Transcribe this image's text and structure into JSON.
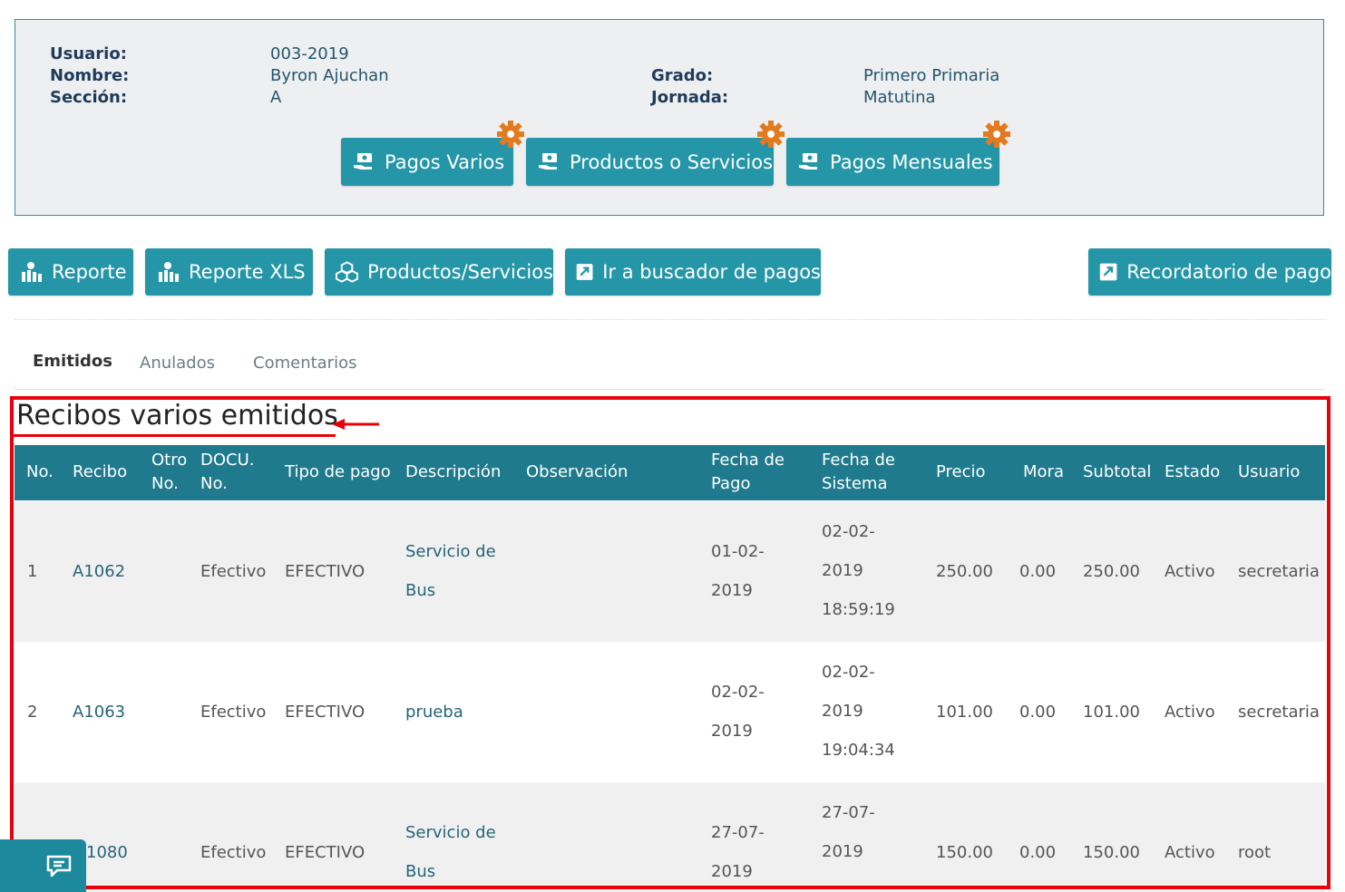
{
  "student": {
    "usuario_label": "Usuario:",
    "usuario_value": "003-2019",
    "nombre_label": "Nombre:",
    "nombre_value": "Byron Ajuchan",
    "seccion_label": "Sección:",
    "seccion_value": "A",
    "grado_label": "Grado:",
    "grado_value": "Primero Primaria",
    "jornada_label": "Jornada:",
    "jornada_value": "Matutina"
  },
  "payment_buttons": {
    "pagos_varios": "Pagos Varios",
    "productos_servicios": "Productos o Servicios",
    "pagos_mensuales": "Pagos Mensuales"
  },
  "actions": {
    "reporte": "Reporte",
    "reporte_xls": "Reporte XLS",
    "productos": "Productos/Servicios",
    "buscador": "Ir a buscador de pagos",
    "recordatorio": "Recordatorio de pago"
  },
  "tabs": [
    "Emitidos",
    "Anulados",
    "Comentarios"
  ],
  "section_title": "Recibos varios emitidos",
  "table": {
    "headers": {
      "no": "No.",
      "recibo": "Recibo",
      "otro_1": "Otro",
      "otro_2": "No.",
      "docu_1": "DOCU.",
      "docu_2": "No.",
      "tipo": "Tipo de pago",
      "descripcion": "Descripción",
      "observacion": "Observación",
      "fpago_1": "Fecha de",
      "fpago_2": "Pago",
      "fsis_1": "Fecha de",
      "fsis_2": "Sistema",
      "precio": "Precio",
      "mora": "Mora",
      "subtotal": "Subtotal",
      "estado": "Estado",
      "usuario": "Usuario"
    },
    "rows": [
      {
        "no": "1",
        "recibo": "A1062",
        "docu": "Efectivo",
        "tipo": "EFECTIVO",
        "desc_1": "Servicio de",
        "desc_2": "Bus",
        "fpago_1": "01-02-",
        "fpago_2": "2019",
        "fsis_1": "02-02-",
        "fsis_2": "2019",
        "fsis_3": "18:59:19",
        "precio": "250.00",
        "mora": "0.00",
        "subtotal": "250.00",
        "estado": "Activo",
        "usuario": "secretaria"
      },
      {
        "no": "2",
        "recibo": "A1063",
        "docu": "Efectivo",
        "tipo": "EFECTIVO",
        "desc_1": "prueba",
        "fpago_1": "02-02-",
        "fpago_2": "2019",
        "fsis_1": "02-02-",
        "fsis_2": "2019",
        "fsis_3": "19:04:34",
        "precio": "101.00",
        "mora": "0.00",
        "subtotal": "101.00",
        "estado": "Activo",
        "usuario": "secretaria"
      },
      {
        "recibo": "1080",
        "docu": "Efectivo",
        "tipo": "EFECTIVO",
        "desc_1": "Servicio de",
        "desc_2": "Bus",
        "fpago_1": "27-07-",
        "fpago_2": "2019",
        "fsis_1": "27-07-",
        "fsis_2": "2019",
        "precio": "150.00",
        "mora": "0.00",
        "subtotal": "150.00",
        "estado": "Activo",
        "usuario": "root"
      }
    ]
  },
  "colors": {
    "teal_button": "#2596a8",
    "table_header": "#1e7a8c",
    "highlight": "#e8000b",
    "gear": "#e37a1f"
  },
  "icons": [
    "money-hand-icon",
    "gear-icon",
    "chart-money-icon",
    "boxes-icon",
    "external-link-icon",
    "chat-icon",
    "red-arrow-icon"
  ]
}
